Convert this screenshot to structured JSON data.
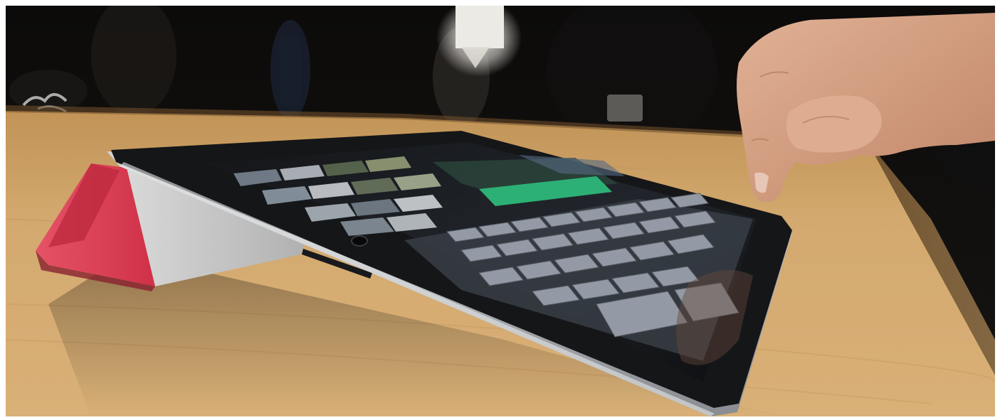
{
  "image": {
    "kind": "photograph",
    "colors": {
      "frame": "#ffffff",
      "background": "#0a0908",
      "table_wood": "#d6a86a",
      "cover_outer": "#e8435a",
      "cover_inner": "#cfcfcf",
      "tablet_frame": "#1a1b1e",
      "tablet_bezel_metal": "#b9bcc0",
      "keyboard_key": "#9aa1ac",
      "screen_highlight": "#2fb87a",
      "skin": "#e0a98a"
    }
  }
}
